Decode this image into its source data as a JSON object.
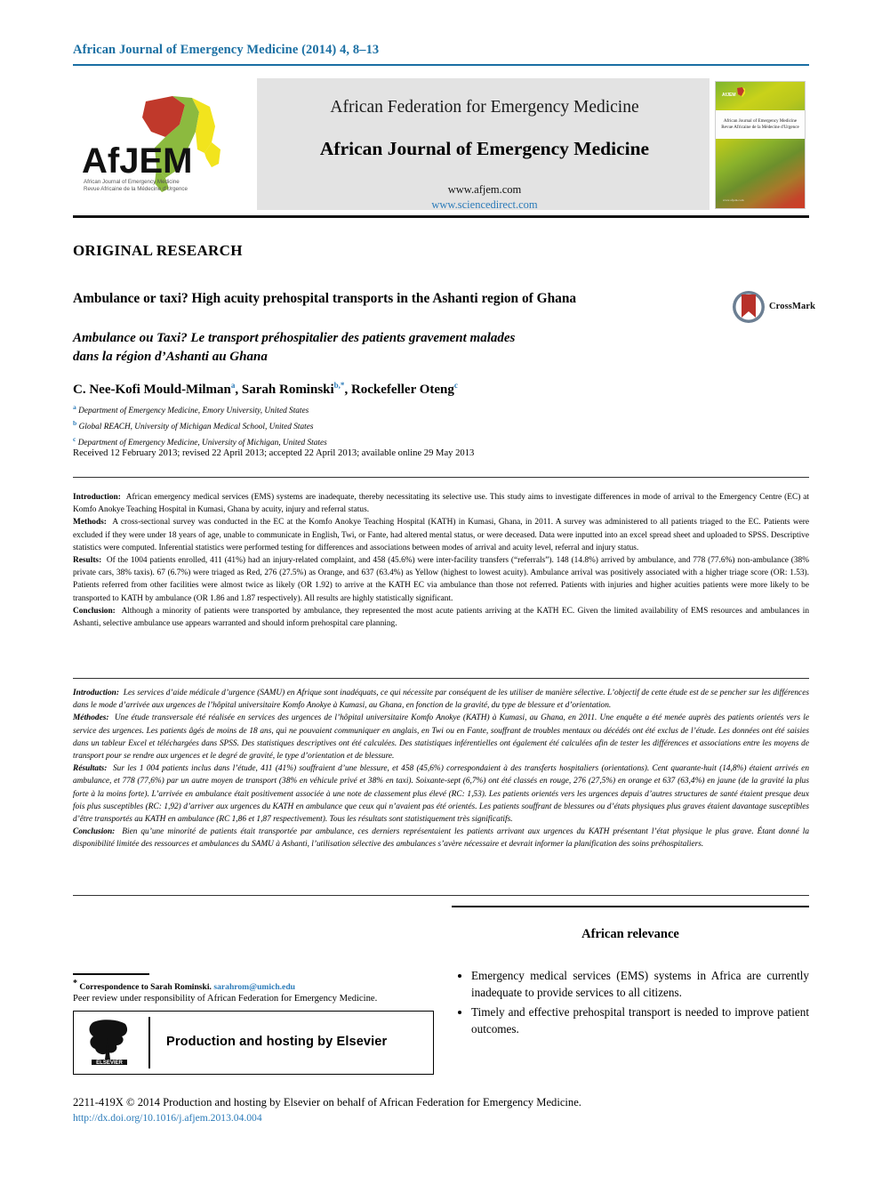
{
  "running_head": "African Journal of Emergency Medicine (2014) 4, 8–13",
  "masthead": {
    "logo_alt": "AfJEM",
    "logo_wordmark": "AfJEM",
    "logo_tagline_line1": "African Journal of Emergency Medicine",
    "logo_tagline_line2": "Revue Africaine de la Médecine d'Urgence",
    "federation": "African Federation for Emergency Medicine",
    "journal": "African Journal of Emergency Medicine",
    "url_journal": "www.afjem.com",
    "url_sciencedirect": "www.sciencedirect.com",
    "cover": {
      "title_line1": "African Journal of Emergency Medicine",
      "title_line2": "Revue Africaine de la Médecine d'Urgence",
      "footer": "www.afjem.com"
    }
  },
  "article": {
    "kicker": "ORIGINAL RESEARCH",
    "title_en": "Ambulance or taxi? High acuity prehospital transports in the Ashanti region of Ghana",
    "title_fr_line1": "Ambulance ou Taxi? Le transport préhospitalier des patients gravement malades",
    "title_fr_line2": "dans la région d’Ashanti au Ghana",
    "crossmark_label": "CrossMark",
    "authors": [
      {
        "name": "C. Nee-Kofi Mould-Milman",
        "marks": "a"
      },
      {
        "name": "Sarah Rominski",
        "marks": "b,*"
      },
      {
        "name": "Rockefeller Oteng",
        "marks": "c"
      }
    ],
    "affiliations": [
      {
        "mark": "a",
        "text": "Department of Emergency Medicine, Emory University, United States"
      },
      {
        "mark": "b",
        "text": "Global REACH, University of Michigan Medical School, United States"
      },
      {
        "mark": "c",
        "text": "Department of Emergency Medicine, University of Michigan, United States"
      }
    ],
    "history": "Received 12 February 2013; revised 22 April 2013; accepted 22 April 2013; available online 29 May 2013"
  },
  "abstract_en": {
    "introduction_label": "Introduction:",
    "introduction_text": "African emergency medical services (EMS) systems are inadequate, thereby necessitating its selective use. This study aims to investigate differences in mode of arrival to the Emergency Centre (EC) at Komfo Anokye Teaching Hospital in Kumasi, Ghana by acuity, injury and referral status.",
    "methods_label": "Methods:",
    "methods_text": "A cross-sectional survey was conducted in the EC at the Komfo Anokye Teaching Hospital (KATH) in Kumasi, Ghana, in 2011. A survey was administered to all patients triaged to the EC. Patients were excluded if they were under 18 years of age, unable to communicate in English, Twi, or Fante, had altered mental status, or were deceased. Data were inputted into an excel spread sheet and uploaded to SPSS. Descriptive statistics were computed. Inferential statistics were performed testing for differences and associations between modes of arrival and acuity level, referral and injury status.",
    "results_label": "Results:",
    "results_text": "Of the 1004 patients enrolled, 411 (41%) had an injury-related complaint, and 458 (45.6%) were inter-facility transfers (“referrals”). 148 (14.8%) arrived by ambulance, and 778 (77.6%) non-ambulance (38% private cars, 38% taxis). 67 (6.7%) were triaged as Red, 276 (27.5%) as Orange, and 637 (63.4%) as Yellow (highest to lowest acuity). Ambulance arrival was positively associated with a higher triage score (OR: 1.53). Patients referred from other facilities were almost twice as likely (OR 1.92) to arrive at the KATH EC via ambulance than those not referred. Patients with injuries and higher acuities patients were more likely to be transported to KATH by ambulance (OR 1.86 and 1.87 respectively). All results are highly statistically significant.",
    "conclusion_label": "Conclusion:",
    "conclusion_text": "Although a minority of patients were transported by ambulance, they represented the most acute patients arriving at the KATH EC. Given the limited availability of EMS resources and ambulances in Ashanti, selective ambulance use appears warranted and should inform prehospital care planning."
  },
  "abstract_fr": {
    "introduction_label": "Introduction:",
    "introduction_text": "Les services d’aide médicale d’urgence (SAMU) en Afrique sont inadéquats, ce qui nécessite par conséquent de les utiliser de manière sélective. L’objectif de cette étude est de se pencher sur les différences dans le mode d’arrivée aux urgences de l’hôpital universitaire Komfo Anokye à Kumasi, au Ghana, en fonction de la gravité, du type de blessure et d’orientation.",
    "methods_label": "Méthodes:",
    "methods_text": "Une étude transversale été réalisée en services des urgences de l’hôpital universitaire Komfo Anokye (KATH) à Kumasi, au Ghana, en 2011. Une enquête a été menée auprès des patients orientés vers le service des urgences. Les patients âgés de moins de 18 ans, qui ne pouvaient communiquer en anglais, en Twi ou en Fante, souffrant de troubles mentaux ou décédés ont été exclus de l’étude. Les données ont été saisies dans un tableur Excel et téléchargées dans SPSS. Des statistiques descriptives ont été calculées. Des statistiques inférentielles ont également été calculées afin de tester les différences et associations entre les moyens de transport pour se rendre aux urgences et le degré de gravité, le type d’orientation et de blessure.",
    "results_label": "Résultats:",
    "results_text": "Sur les 1 004 patients inclus dans l’étude, 411 (41%) souffraient d’une blessure, et 458 (45,6%) correspondaient à des transferts hospitaliers (orientations). Cent quarante-huit (14,8%) étaient arrivés en ambulance, et 778 (77,6%) par un autre moyen de transport (38% en véhicule privé et 38% en taxi). Soixante-sept (6,7%) ont été classés en rouge, 276 (27,5%) en orange et 637 (63,4%) en jaune (de la gravité la plus forte à la moins forte). L’arrivée en ambulance était positivement associée à une note de classement plus élevé (RC: 1,53). Les patients orientés vers les urgences depuis d’autres structures de santé étaient presque deux fois plus susceptibles (RC: 1,92) d’arriver aux urgences du KATH en ambulance que ceux qui n’avaient pas été orientés. Les patients souffrant de blessures ou d’états physiques plus graves étaient davantage susceptibles d’être transportés au KATH en ambulance (RC 1,86 et 1,87 respectivement). Tous les résultats sont statistiquement très significatifs.",
    "conclusion_label": "Conclusion:",
    "conclusion_text": "Bien qu’une minorité de patients était transportée par ambulance, ces derniers représentaient les patients arrivant aux urgences du KATH présentant l’état physique le plus grave. Étant donné la disponibilité limitée des ressources et ambulances du SAMU à Ashanti, l’utilisation sélective des ambulances s’avère nécessaire et devrait informer la planification des soins préhospitaliers."
  },
  "relevance": {
    "title": "African relevance",
    "bullets": [
      "Emergency medical services (EMS) systems in Africa are currently inadequate to provide services to all citizens.",
      "Timely and effective prehospital transport is needed to improve patient outcomes."
    ]
  },
  "footer": {
    "correspondence_star": "*",
    "correspondence_text": "Correspondence to Sarah Rominski.",
    "correspondence_email": "sarahrom@umich.edu",
    "peer_review": "Peer review under responsibility of African Federation for Emergency Medicine.",
    "elsevier_label": "Production and hosting by Elsevier",
    "elsevier_wordmark": "ELSEVIER",
    "issn_line": "2211-419X © 2014 Production and hosting by Elsevier on behalf of African Federation for Emergency Medicine.",
    "doi": "http://dx.doi.org/10.1016/j.afjem.2013.04.004"
  },
  "colors": {
    "accent_blue": "#1a6fa3",
    "link_blue": "#2b7bb9",
    "masthead_grey": "#e3e3e3",
    "logo_red": "#c0392b",
    "logo_green": "#8cba3f",
    "logo_yellow": "#f2e41d"
  }
}
